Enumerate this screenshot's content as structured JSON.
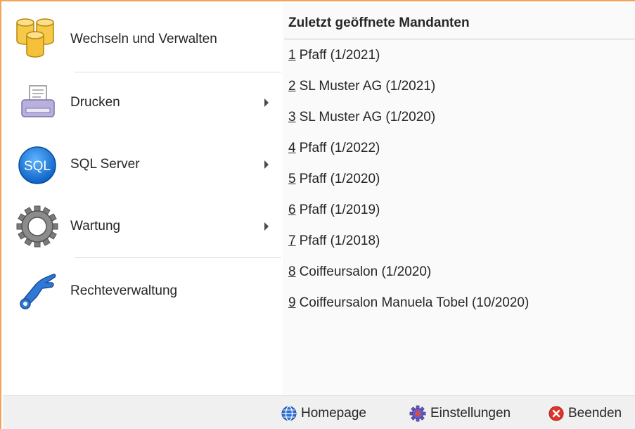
{
  "menu": {
    "items": [
      {
        "label": "Wechseln und Verwalten",
        "icon": "database-stack-icon",
        "has_submenu": false
      },
      {
        "label": "Drucken",
        "icon": "printer-icon",
        "has_submenu": true
      },
      {
        "label": "SQL Server",
        "icon": "sql-icon",
        "has_submenu": true
      },
      {
        "label": "Wartung",
        "icon": "gear-icon",
        "has_submenu": true
      },
      {
        "label": "Rechteverwaltung",
        "icon": "key-hand-icon",
        "has_submenu": false
      }
    ],
    "sql_icon_text": "SQL"
  },
  "recent": {
    "title": "Zuletzt geöffnete Mandanten",
    "items": [
      {
        "num": "1",
        "label": "Pfaff (1/2021)"
      },
      {
        "num": "2",
        "label": "SL Muster AG (1/2021)"
      },
      {
        "num": "3",
        "label": "SL Muster AG (1/2020)"
      },
      {
        "num": "4",
        "label": "Pfaff (1/2022)"
      },
      {
        "num": "5",
        "label": "Pfaff (1/2020)"
      },
      {
        "num": "6",
        "label": "Pfaff (1/2019)"
      },
      {
        "num": "7",
        "label": "Pfaff (1/2018)"
      },
      {
        "num": "8",
        "label": "Coiffeursalon (1/2020)"
      },
      {
        "num": "9",
        "label": "Coiffeursalon Manuela Tobel (10/2020)"
      }
    ]
  },
  "footer": {
    "homepage": "Homepage",
    "settings": "Einstellungen",
    "quit": "Beenden"
  },
  "colors": {
    "frame_border": "#f3a45c",
    "recent_bg": "#fafafa",
    "footer_bg": "#f0f0f0"
  }
}
